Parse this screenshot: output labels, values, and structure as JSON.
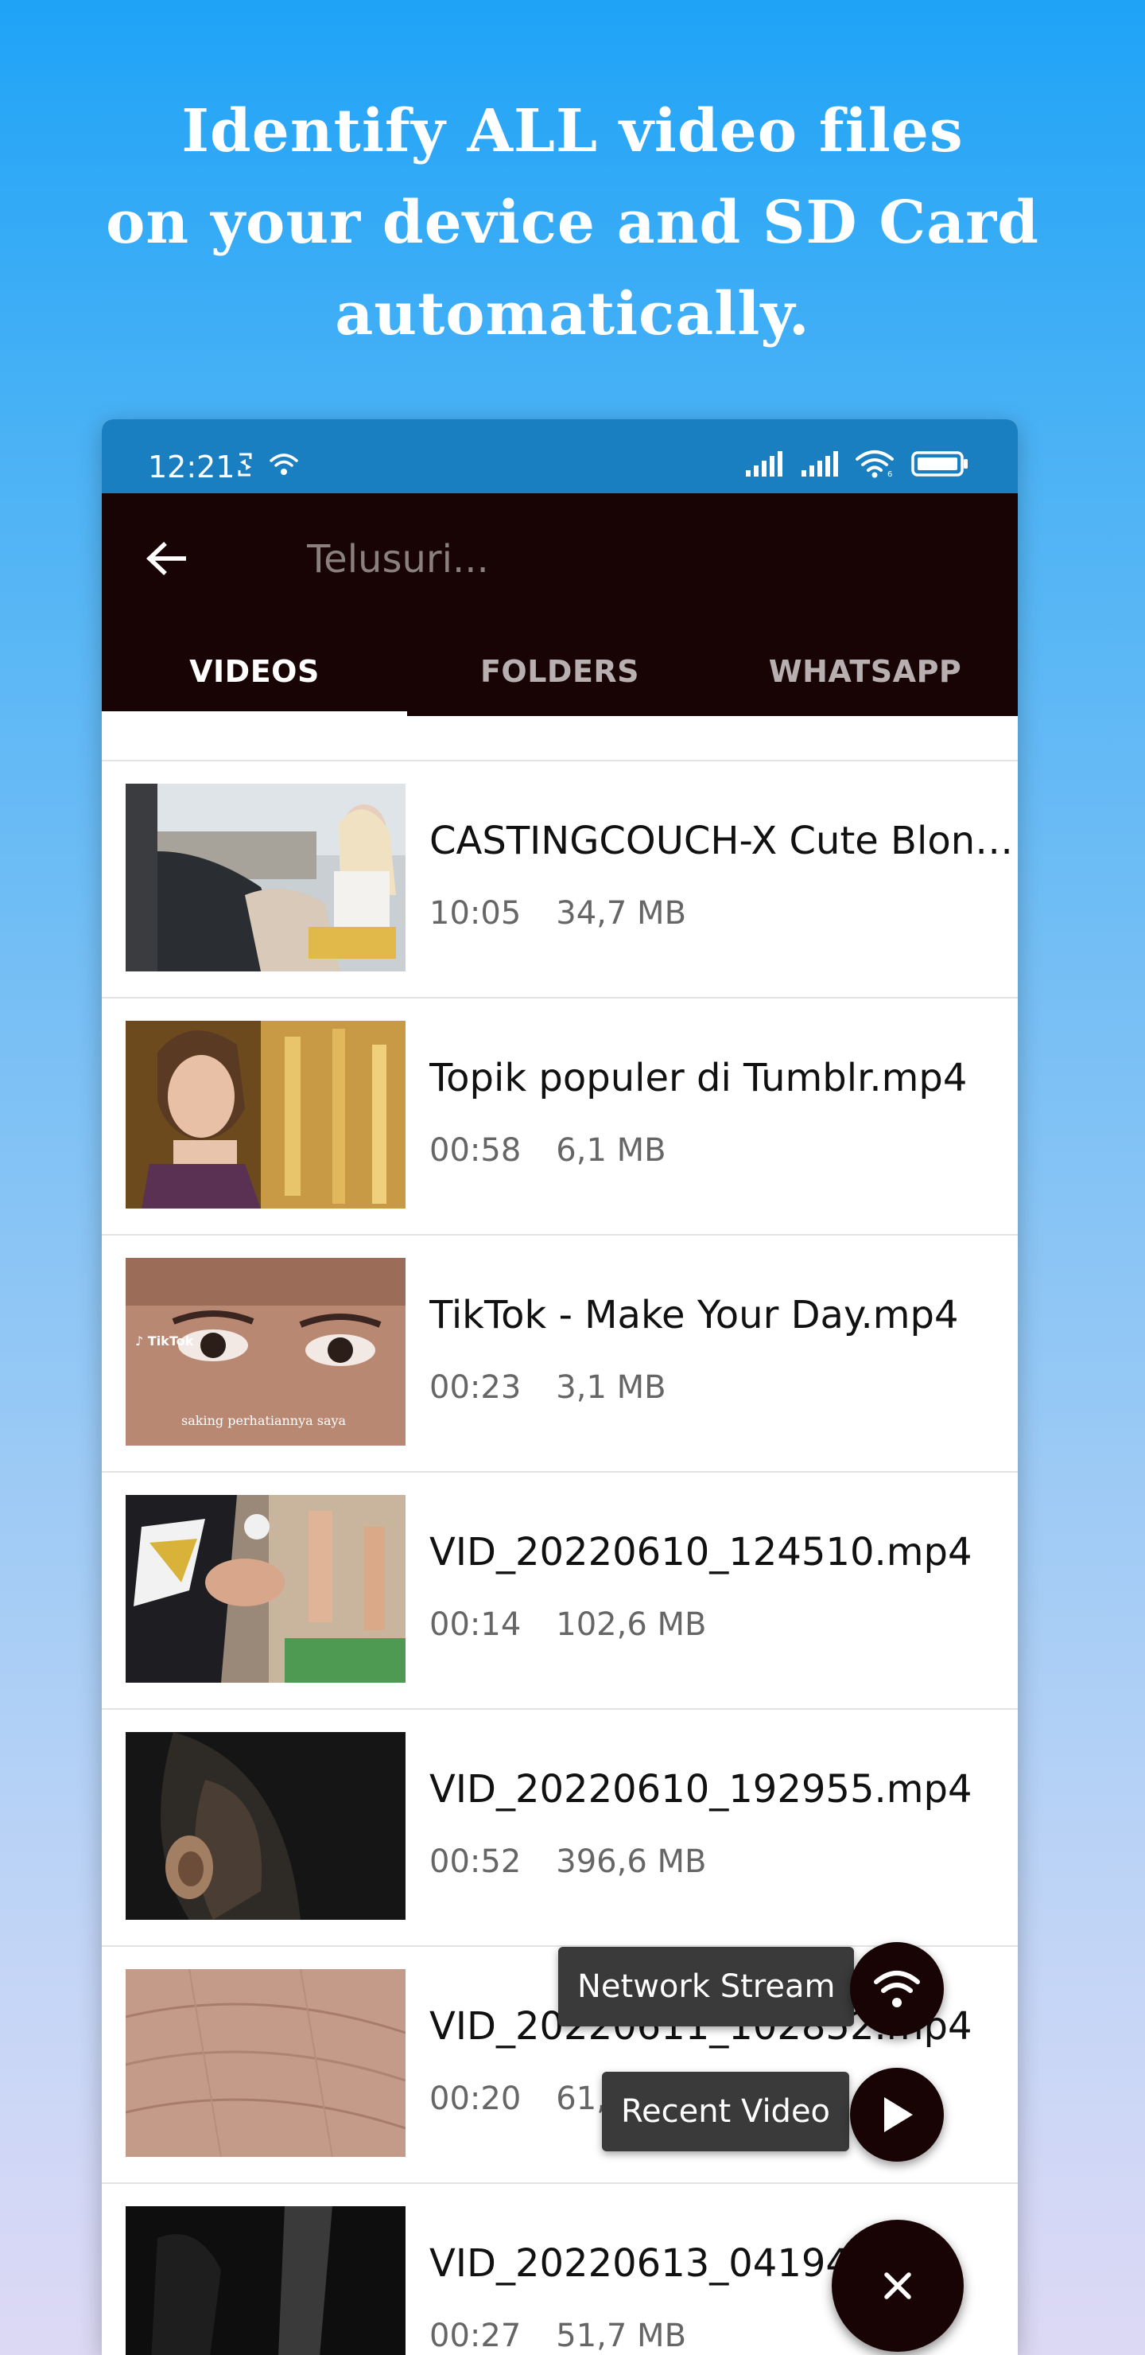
{
  "headline": {
    "line1": "Identify ALL video files",
    "line2": "on your device and SD Card",
    "line3": "automatically."
  },
  "status_bar": {
    "time": "12:21"
  },
  "toolbar": {
    "back_icon": "arrow-left-icon",
    "search_placeholder": "Telusuri..."
  },
  "tabs": [
    {
      "label": "VIDEOS",
      "active": true
    },
    {
      "label": "FOLDERS",
      "active": false
    },
    {
      "label": "WHATSAPP",
      "active": false
    }
  ],
  "videos": [
    {
      "title": "CASTINGCOUCH-X Cute Blonde...",
      "duration": "10:05",
      "size": "34,7 MB"
    },
    {
      "title": "Topik populer di Tumblr.mp4",
      "duration": "00:58",
      "size": "6,1 MB"
    },
    {
      "title": "TikTok - Make Your Day.mp4",
      "duration": "00:23",
      "size": "3,1 MB"
    },
    {
      "title": "VID_20220610_124510.mp4",
      "duration": "00:14",
      "size": "102,6 MB"
    },
    {
      "title": "VID_20220610_192955.mp4",
      "duration": "00:52",
      "size": "396,6 MB"
    },
    {
      "title": "VID_20220611_102852.mp4",
      "duration": "00:20",
      "size": "61,4 MB"
    },
    {
      "title": "VID_20220613_041945_R...",
      "duration": "00:27",
      "size": "51,7 MB"
    }
  ],
  "fab": {
    "network_stream_label": "Network Stream",
    "recent_video_label": "Recent Video",
    "network_icon": "wifi-icon",
    "recent_icon": "play-icon",
    "close_icon": "close-icon"
  },
  "colors": {
    "background_top": "#1fa3f7",
    "background_bottom": "#ddd9f5",
    "status_bar": "#1a7fc1",
    "toolbar": "#180404",
    "fab": "#180404",
    "tooltip": "#3a3a3a"
  }
}
